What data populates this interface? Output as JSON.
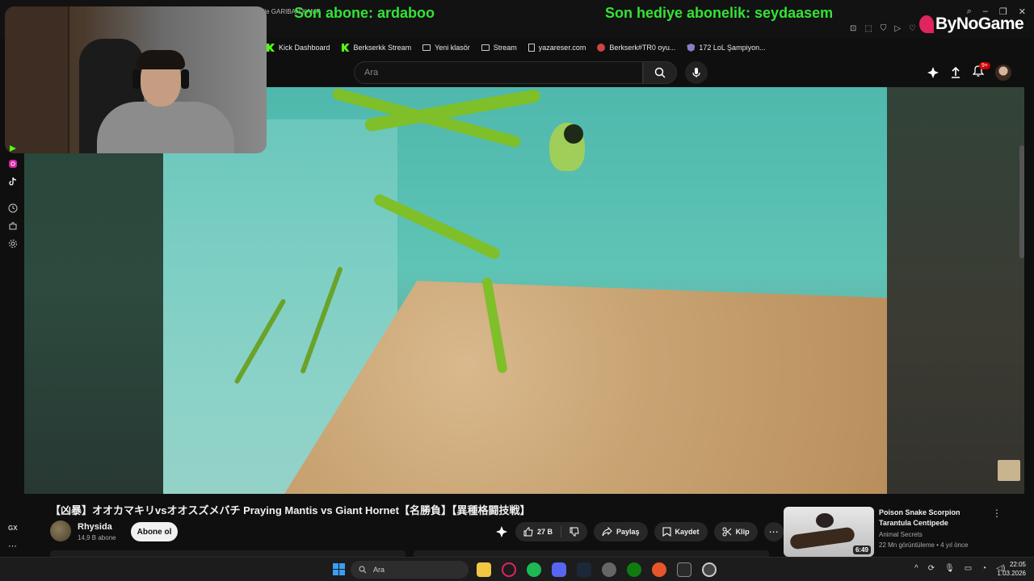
{
  "overlay": {
    "last_sub_label": "Son abone: ardaboo",
    "last_gift_label": "Son hediye abonelik: seydaasem",
    "tab_fragment": "¹² ile GARIBAN KAMP",
    "logo_text": "ByNoGame"
  },
  "bookmarks": [
    {
      "label": "Kick Dashboard",
      "icon": "kick-icon"
    },
    {
      "label": "Berkserkk Stream",
      "icon": "kick-icon"
    },
    {
      "label": "Yeni klasör",
      "icon": "folder-icon"
    },
    {
      "label": "Stream",
      "icon": "folder-icon"
    },
    {
      "label": "yazareser.com",
      "icon": "page-icon"
    },
    {
      "label": "Berkserk#TR0 oyu...",
      "icon": "round-icon"
    },
    {
      "label": "172 LoL Şampiyon...",
      "icon": "shield-icon"
    }
  ],
  "header": {
    "search_placeholder": "Ara",
    "notifications_badge": "9+"
  },
  "video": {
    "title": "【凶暴】オオカマキリvsオオスズメバチ Praying Mantis vs Giant Hornet【名勝負】【異種格闘技戦】",
    "channel_name": "Rhysida",
    "channel_subs": "14,9 B abone",
    "subscribe_label": "Abone ol",
    "like_count": "27 B",
    "share_label": "Paylaş",
    "save_label": "Kaydet",
    "clip_label": "Klip"
  },
  "recommendation": {
    "title": "Poison Snake Scorpion Tarantula Centipede",
    "channel": "Animal Secrets",
    "meta": "22 Mn görüntüleme • 4 yıl önce",
    "duration": "6:49"
  },
  "left_rail": {
    "gx_label": "GX"
  },
  "taskbar": {
    "search_label": "Ara",
    "time": "22:05",
    "date": "1.03.2026"
  },
  "colors": {
    "overlay_green": "#34e334",
    "accent_red": "#cc0000",
    "kick_green": "#53fc18"
  }
}
